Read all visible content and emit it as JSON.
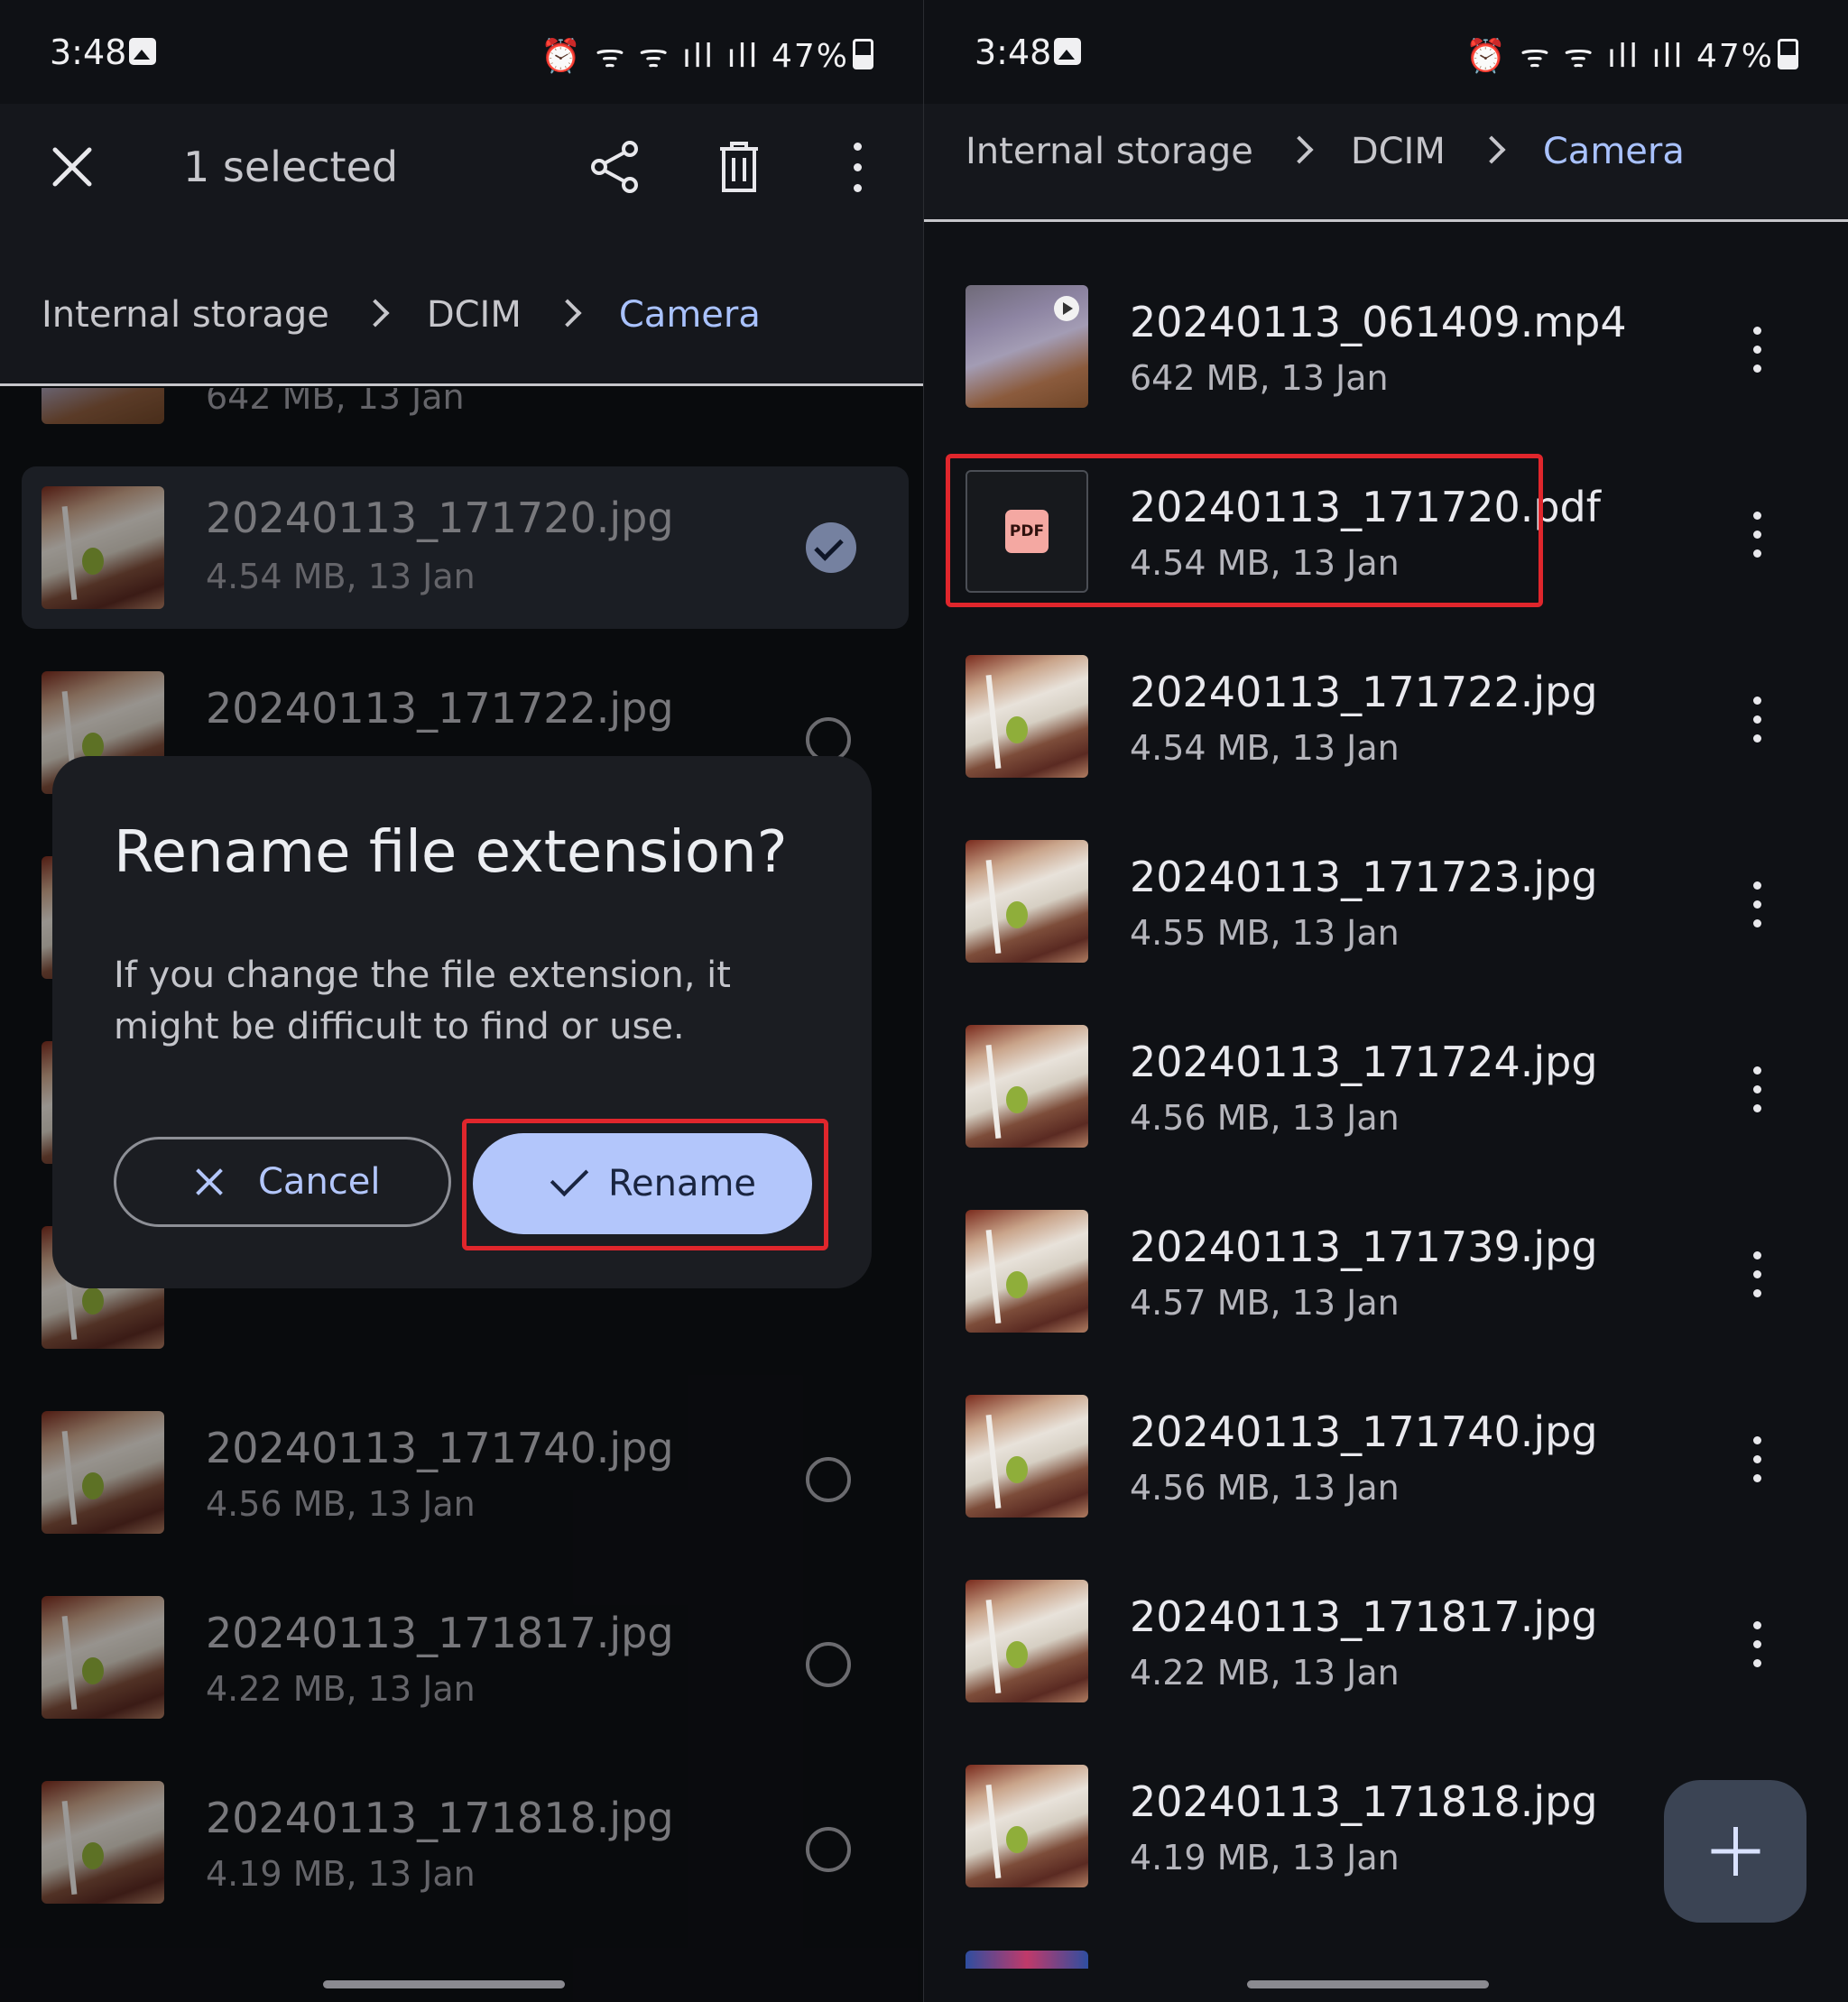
{
  "status": {
    "time": "3:48",
    "icons": "⏰ ᯤ ᯤ ıll ıll",
    "battery": "47%"
  },
  "left": {
    "selection_bar": {
      "title": "1 selected"
    },
    "breadcrumb": [
      "Internal storage",
      "DCIM",
      "Camera"
    ],
    "partial_top_meta": "642 MB, 13 Jan",
    "files": [
      {
        "name": "20240113_171720.jpg",
        "meta": "4.54 MB, 13 Jan",
        "selected": true
      },
      {
        "name": "20240113_171722.jpg",
        "meta": "",
        "selected": false
      },
      {
        "name": "20240113_171740.jpg",
        "meta": "4.56 MB, 13 Jan",
        "selected": false
      },
      {
        "name": "20240113_171817.jpg",
        "meta": "4.22 MB, 13 Jan",
        "selected": false
      },
      {
        "name": "20240113_171818.jpg",
        "meta": "4.19 MB, 13 Jan",
        "selected": false
      }
    ],
    "dialog": {
      "title": "Rename file extension?",
      "body": "If you change the file extension, it might be difficult to find or use.",
      "cancel_label": "Cancel",
      "confirm_label": "Rename"
    }
  },
  "right": {
    "breadcrumb": [
      "Internal storage",
      "DCIM",
      "Camera"
    ],
    "files": [
      {
        "name": "20240113_061409.mp4",
        "meta": "642 MB, 13 Jan",
        "kind": "video"
      },
      {
        "name": "20240113_171720.pdf",
        "meta": "4.54 MB, 13 Jan",
        "kind": "pdf",
        "badge": "PDF"
      },
      {
        "name": "20240113_171722.jpg",
        "meta": "4.54 MB, 13 Jan",
        "kind": "image"
      },
      {
        "name": "20240113_171723.jpg",
        "meta": "4.55 MB, 13 Jan",
        "kind": "image"
      },
      {
        "name": "20240113_171724.jpg",
        "meta": "4.56 MB, 13 Jan",
        "kind": "image"
      },
      {
        "name": "20240113_171739.jpg",
        "meta": "4.57 MB, 13 Jan",
        "kind": "image"
      },
      {
        "name": "20240113_171740.jpg",
        "meta": "4.56 MB, 13 Jan",
        "kind": "image"
      },
      {
        "name": "20240113_171817.jpg",
        "meta": "4.22 MB, 13 Jan",
        "kind": "image"
      },
      {
        "name": "20240113_171818.jpg",
        "meta": "4.19 MB, 13 Jan",
        "kind": "image"
      }
    ]
  },
  "colors": {
    "accent": "#a9c2ff",
    "highlight": "#e0262c",
    "background": "#0f1115"
  }
}
